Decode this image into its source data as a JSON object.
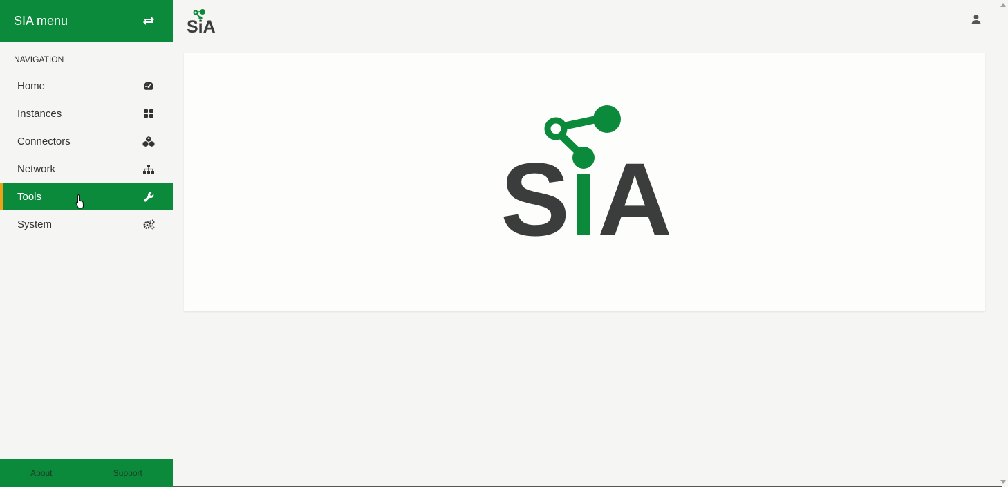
{
  "sidebar": {
    "title": "SIA menu",
    "toggle_icon": "swap-arrows-icon",
    "section_heading": "NAVIGATION",
    "items": [
      {
        "label": "Home",
        "icon": "dashboard-icon"
      },
      {
        "label": "Instances",
        "icon": "grid-icon"
      },
      {
        "label": "Connectors",
        "icon": "cubes-icon"
      },
      {
        "label": "Network",
        "icon": "sitemap-icon"
      },
      {
        "label": "Tools",
        "icon": "wrench-icon",
        "active": true
      },
      {
        "label": "System",
        "icon": "gears-icon"
      }
    ],
    "footer": {
      "about": "About",
      "support": "Support"
    }
  },
  "header": {
    "logo_text": "SiA",
    "user_icon": "user-icon"
  },
  "main": {
    "logo_text": "SiA"
  },
  "colors": {
    "brand_green": "#0b8a3b",
    "active_border": "#e8a317",
    "logo_dark": "#3a3d3c"
  }
}
